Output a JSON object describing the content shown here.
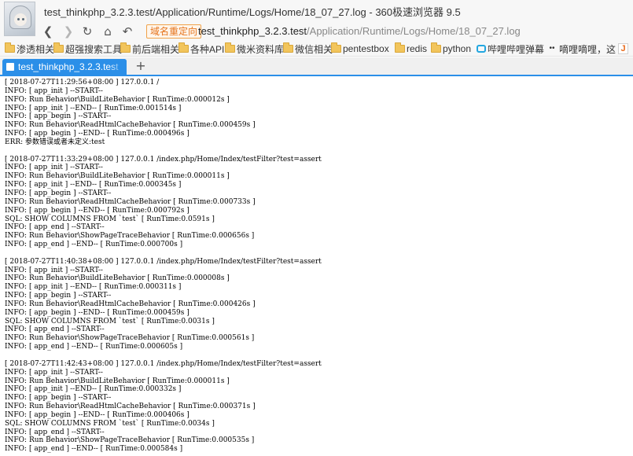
{
  "window": {
    "title": "test_thinkphp_3.2.3.test/Application/Runtime/Logs/Home/18_07_27.log - 360极速浏览器 9.5"
  },
  "navbar": {
    "back_icon": "back-arrow-icon",
    "forward_icon": "forward-arrow-icon",
    "reload_icon": "reload-icon",
    "home_icon": "home-icon",
    "undo_icon": "undo-icon",
    "redirect_badge": "域名重定向",
    "url_host": "test_thinkphp_3.2.3.test",
    "url_path": "/Application/Runtime/Logs/Home/18_07_27.log"
  },
  "bookmarks": [
    {
      "label": "渗透相关",
      "icon": "folder-icon"
    },
    {
      "label": "超强搜索工具",
      "icon": "folder-icon"
    },
    {
      "label": "前后端相关",
      "icon": "folder-icon"
    },
    {
      "label": "各种API",
      "icon": "folder-icon"
    },
    {
      "label": "微米资料库",
      "icon": "folder-icon"
    },
    {
      "label": "微信相关",
      "icon": "folder-icon"
    },
    {
      "label": "pentestbox",
      "icon": "folder-icon"
    },
    {
      "label": "redis",
      "icon": "folder-icon"
    },
    {
      "label": "python",
      "icon": "folder-icon"
    },
    {
      "label": "哔哩哔哩弹幕",
      "icon": "bilibili-icon"
    },
    {
      "label": "嘀哩嘀哩，这",
      "icon": "emoji-icon"
    }
  ],
  "tabs": {
    "active_label": "test_thinkphp_3.2.3.test",
    "new_tab_symbol": "+"
  },
  "colors": {
    "accent": "#2b8fe8",
    "redirect_badge": "#e6751e"
  },
  "log_lines": [
    "[ 2018-07-27T11:29:56+08:00 ] 127.0.0.1 /",
    "INFO: [ app_init ] --START--",
    "INFO: Run Behavior\\BuildLiteBehavior [ RunTime:0.000012s ]",
    "INFO: [ app_init ] --END-- [ RunTime:0.001514s ]",
    "INFO: [ app_begin ] --START--",
    "INFO: Run Behavior\\ReadHtmlCacheBehavior [ RunTime:0.000459s ]",
    "INFO: [ app_begin ] --END-- [ RunTime:0.000496s ]",
    "ERR: 参数错误或者未定义:test",
    "",
    "[ 2018-07-27T11:33:29+08:00 ] 127.0.0.1 /index.php/Home/Index/testFilter?test=assert",
    "INFO: [ app_init ] --START--",
    "INFO: Run Behavior\\BuildLiteBehavior [ RunTime:0.000011s ]",
    "INFO: [ app_init ] --END-- [ RunTime:0.000345s ]",
    "INFO: [ app_begin ] --START--",
    "INFO: Run Behavior\\ReadHtmlCacheBehavior [ RunTime:0.000733s ]",
    "INFO: [ app_begin ] --END-- [ RunTime:0.000792s ]",
    "SQL: SHOW COLUMNS FROM `test` [ RunTime:0.0591s ]",
    "INFO: [ app_end ] --START--",
    "INFO: Run Behavior\\ShowPageTraceBehavior [ RunTime:0.000656s ]",
    "INFO: [ app_end ] --END-- [ RunTime:0.000700s ]",
    "",
    "[ 2018-07-27T11:40:38+08:00 ] 127.0.0.1 /index.php/Home/Index/testFilter?test=assert",
    "INFO: [ app_init ] --START--",
    "INFO: Run Behavior\\BuildLiteBehavior [ RunTime:0.000008s ]",
    "INFO: [ app_init ] --END-- [ RunTime:0.000311s ]",
    "INFO: [ app_begin ] --START--",
    "INFO: Run Behavior\\ReadHtmlCacheBehavior [ RunTime:0.000426s ]",
    "INFO: [ app_begin ] --END-- [ RunTime:0.000459s ]",
    "SQL: SHOW COLUMNS FROM `test` [ RunTime:0.0031s ]",
    "INFO: [ app_end ] --START--",
    "INFO: Run Behavior\\ShowPageTraceBehavior [ RunTime:0.000561s ]",
    "INFO: [ app_end ] --END-- [ RunTime:0.000605s ]",
    "",
    "[ 2018-07-27T11:42:43+08:00 ] 127.0.0.1 /index.php/Home/Index/testFilter?test=assert",
    "INFO: [ app_init ] --START--",
    "INFO: Run Behavior\\BuildLiteBehavior [ RunTime:0.000011s ]",
    "INFO: [ app_init ] --END-- [ RunTime:0.000332s ]",
    "INFO: [ app_begin ] --START--",
    "INFO: Run Behavior\\ReadHtmlCacheBehavior [ RunTime:0.000371s ]",
    "INFO: [ app_begin ] --END-- [ RunTime:0.000406s ]",
    "SQL: SHOW COLUMNS FROM `test` [ RunTime:0.0034s ]",
    "INFO: [ app_end ] --START--",
    "INFO: Run Behavior\\ShowPageTraceBehavior [ RunTime:0.000535s ]",
    "INFO: [ app_end ] --END-- [ RunTime:0.000584s ]"
  ]
}
